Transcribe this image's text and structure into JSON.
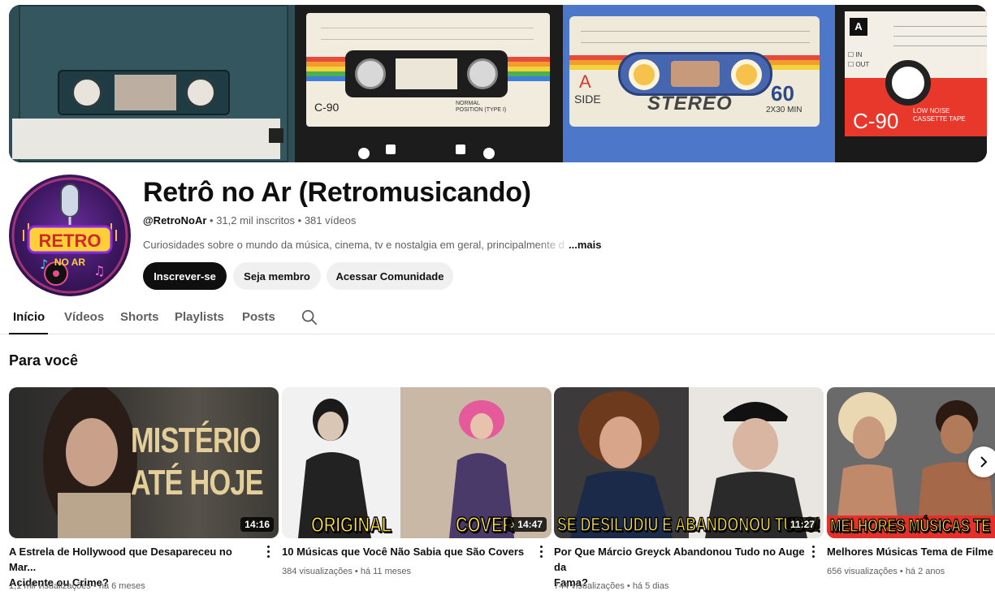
{
  "banner": {
    "tape2": {
      "label": "C-90",
      "position": "NORMAL",
      "position_type": "POSITION (TYPE I)"
    },
    "tape3": {
      "side_letter": "A",
      "side": "SIDE",
      "stereo": "STEREO",
      "length": "60",
      "minutes": "2X30 MIN"
    },
    "tape4": {
      "side_letter": "A",
      "in": "IN",
      "out": "OUT",
      "label": "C-90",
      "noise": "LOW NOISE",
      "cassette": "CASSETTE TAPE"
    }
  },
  "avatar": {
    "line1": "RETRO",
    "line2": "NO AR"
  },
  "channel": {
    "title": "Retrô no Ar (Retromusicando)",
    "handle": "@RetroNoAr",
    "subscribers": "31,2 mil inscritos",
    "videos": "381 vídeos",
    "description": "Curiosidades sobre o mundo da música, cinema, tv e nostalgia em geral, principalmente d",
    "more": "...mais",
    "subscribe_label": "Inscrever-se",
    "member_label": "Seja membro",
    "community_label": "Acessar Comunidade"
  },
  "tabs": [
    "Início",
    "Vídeos",
    "Shorts",
    "Playlists",
    "Posts"
  ],
  "section_title": "Para você",
  "videos": [
    {
      "title_line1": "A Estrela de Hollywood que Desapareceu no Mar...",
      "title_line2": "Acidente ou Crime?",
      "views": "1,1 mil visualizações",
      "age": "há 6 meses",
      "duration": "14:16",
      "overlay1": "MISTÉRIO",
      "overlay2": "ATÉ HOJE"
    },
    {
      "title_line1": "10 Músicas que Você Não Sabia que São Covers",
      "title_line2": "",
      "views": "384 visualizações",
      "age": "há 11 meses",
      "duration": "14:47",
      "overlay1": "ORIGINAL",
      "overlay2": "COVER"
    },
    {
      "title_line1": "Por Que Márcio Greyck Abandonou Tudo no Auge da",
      "title_line2": "Fama?",
      "views": "744 visualizações",
      "age": "há 5 dias",
      "duration": "11:27",
      "overlay1": "SE DESILUDIU E ABANDONOU TUDO!"
    },
    {
      "title_line1": "Melhores Músicas Tema de Filme",
      "title_line2": "",
      "views": "656 visualizações",
      "age": "há 2 anos",
      "overlay1": "MELHORES MÚSICAS TE"
    }
  ]
}
